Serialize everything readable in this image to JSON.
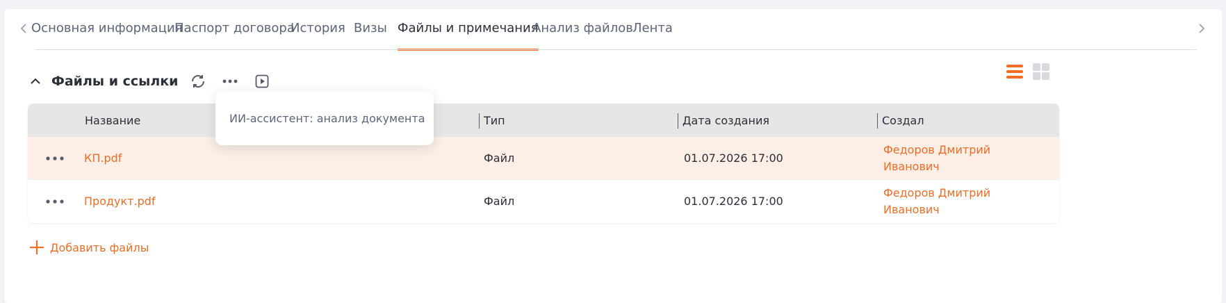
{
  "colors": {
    "accent": "#f26c24",
    "header_bg": "#e6e6e6",
    "row_highlight": "#fdeee6"
  },
  "tabs": [
    {
      "label": "Основная информация"
    },
    {
      "label": "Паспорт договора"
    },
    {
      "label": "История"
    },
    {
      "label": "Визы"
    },
    {
      "label": "Файлы и примечания",
      "active": true
    },
    {
      "label": "Анализ файлов"
    },
    {
      "label": "Лента"
    }
  ],
  "section": {
    "title": "Файлы и ссылки",
    "icons": [
      "chevron-up-icon",
      "refresh-icon",
      "more-icon",
      "play-icon"
    ]
  },
  "view_toggles": [
    "list-view-icon",
    "grid-view-icon"
  ],
  "tooltip": {
    "text": "ИИ-ассистент: анализ документа"
  },
  "table": {
    "headers": {
      "name": "Название",
      "type": "Тип",
      "created": "Дата создания",
      "author": "Создал"
    },
    "rows": [
      {
        "name": "КП.pdf",
        "type": "Файл",
        "created": "01.07.2026 17:00",
        "author_line1": "Федоров Дмитрий",
        "author_line2": "Иванович"
      },
      {
        "name": "Продукт.pdf",
        "type": "Файл",
        "created": "01.07.2026 17:00",
        "author_line1": "Федоров Дмитрий",
        "author_line2": "Иванович"
      }
    ]
  },
  "add_files": {
    "label": "Добавить файлы"
  }
}
